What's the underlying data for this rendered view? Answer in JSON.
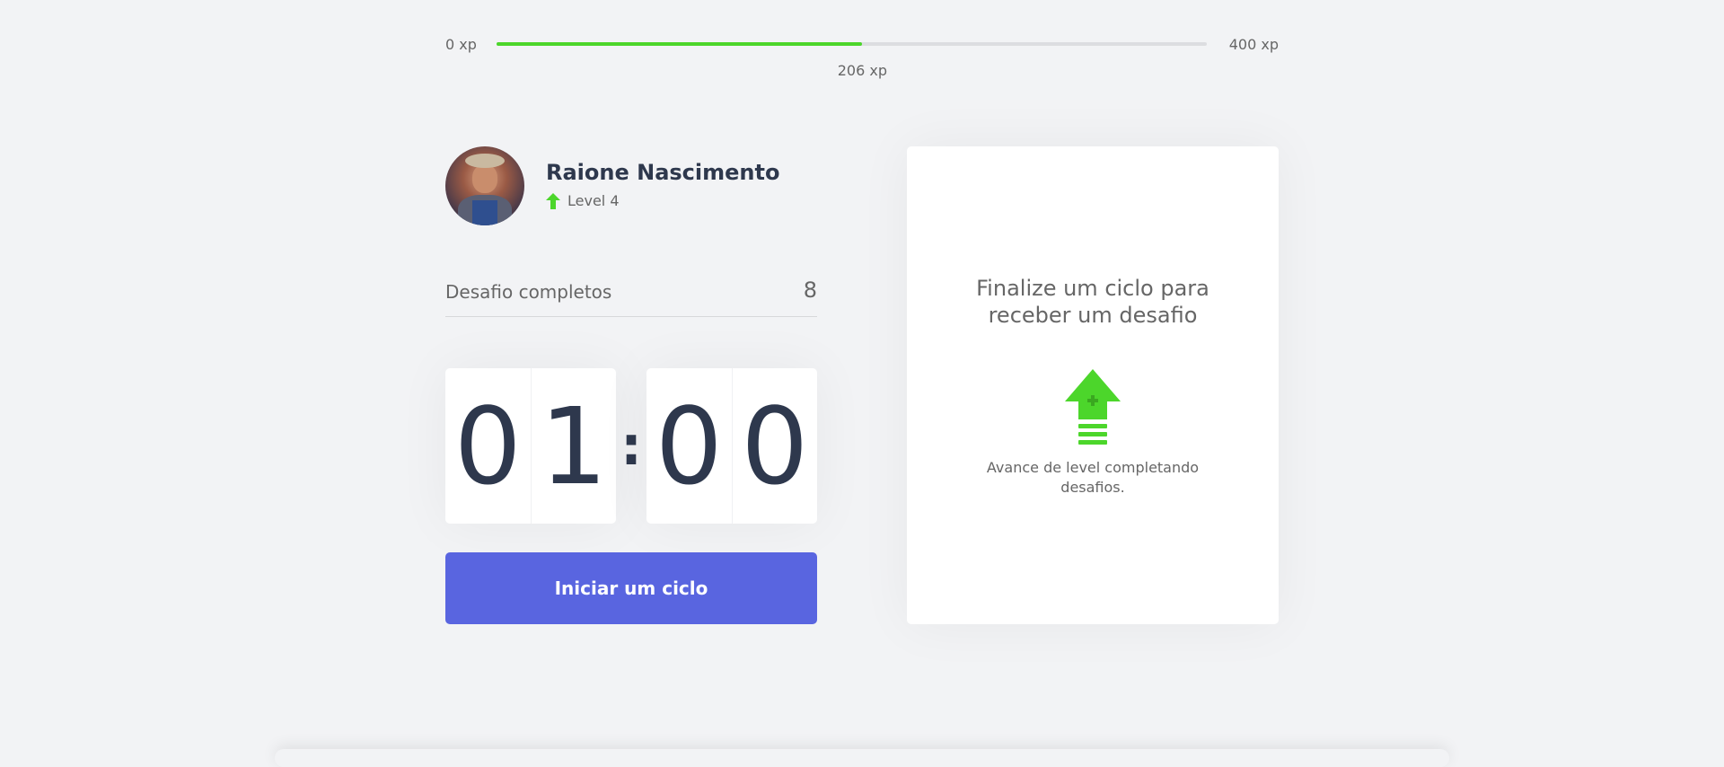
{
  "xp": {
    "min_label": "0 xp",
    "max_label": "400 xp",
    "current_label": "206 xp",
    "current": 206,
    "max": 400,
    "progress_fraction": 0.515
  },
  "profile": {
    "name": "Raione Nascimento",
    "level_label": "Level 4"
  },
  "challenges": {
    "label": "Desafio completos",
    "count": "8"
  },
  "countdown": {
    "minute_left": "0",
    "minute_right": "1",
    "separator": ":",
    "second_left": "0",
    "second_right": "0"
  },
  "actions": {
    "start_label": "Iniciar um ciclo"
  },
  "challenge_card": {
    "title": "Finalize um ciclo para receber um desafio",
    "description": "Avance de level completando desafios."
  },
  "colors": {
    "accent_green": "#4cd62b",
    "button_blue": "#5965e0",
    "text_dark": "#2e384d",
    "background": "#f2f3f5"
  },
  "icons": {
    "level": "level-up-arrow-icon",
    "card": "level-up-arrow-icon"
  }
}
